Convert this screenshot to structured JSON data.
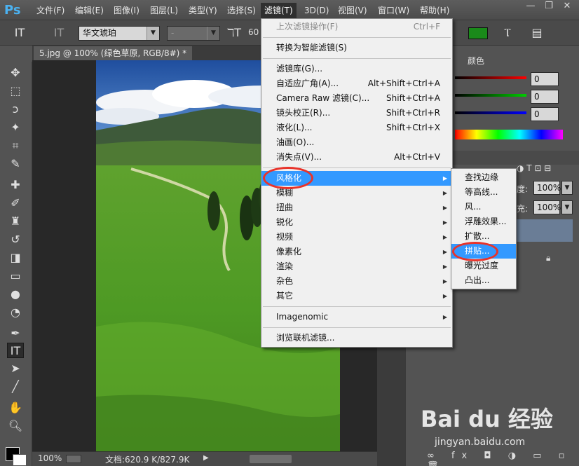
{
  "menubar": {
    "logo": "Ps",
    "items": [
      "文件(F)",
      "编辑(E)",
      "图像(I)",
      "图层(L)",
      "类型(Y)",
      "选择(S)",
      "滤镜(T)",
      "3D(D)",
      "视图(V)",
      "窗口(W)",
      "帮助(H)"
    ],
    "active_index": 6
  },
  "window_controls": {
    "minimize": "—",
    "restore": "❐",
    "close": "✕"
  },
  "options_bar": {
    "font_family": "华文琥珀",
    "font_style": "-",
    "font_size": "60"
  },
  "document": {
    "tab_title": "5.jpg @ 100% (绿色草原, RGB/8#) *",
    "zoom": "100%",
    "doc_info": "文档:620.9 K/827.9K"
  },
  "color_panel": {
    "tab": "颜色",
    "r": "0",
    "g": "0",
    "b": "0"
  },
  "layers_panel": {
    "opacity_label": "度:",
    "opacity_value": "100%",
    "fill_label": "充:",
    "fill_value": "100%"
  },
  "filter_menu": {
    "items": [
      {
        "label": "上次滤镜操作(F)",
        "shortcut": "Ctrl+F",
        "disabled": true
      },
      {
        "label": "转换为智能滤镜(S)",
        "shortcut": ""
      },
      {
        "label": "滤镜库(G)...",
        "shortcut": ""
      },
      {
        "label": "自适应广角(A)...",
        "shortcut": "Alt+Shift+Ctrl+A"
      },
      {
        "label": "Camera Raw 滤镜(C)...",
        "shortcut": "Shift+Ctrl+A"
      },
      {
        "label": "镜头校正(R)...",
        "shortcut": "Shift+Ctrl+R"
      },
      {
        "label": "液化(L)...",
        "shortcut": "Shift+Ctrl+X"
      },
      {
        "label": "油画(O)...",
        "shortcut": ""
      },
      {
        "label": "消失点(V)...",
        "shortcut": "Alt+Ctrl+V"
      },
      {
        "label": "风格化",
        "submenu": true,
        "highlight": true
      },
      {
        "label": "模糊",
        "submenu": true
      },
      {
        "label": "扭曲",
        "submenu": true
      },
      {
        "label": "锐化",
        "submenu": true
      },
      {
        "label": "视频",
        "submenu": true
      },
      {
        "label": "像素化",
        "submenu": true
      },
      {
        "label": "渲染",
        "submenu": true
      },
      {
        "label": "杂色",
        "submenu": true
      },
      {
        "label": "其它",
        "submenu": true
      },
      {
        "label": "Imagenomic",
        "submenu": true
      },
      {
        "label": "浏览联机滤镜...",
        "shortcut": ""
      }
    ]
  },
  "stylize_submenu": {
    "items": [
      "查找边缘",
      "等高线...",
      "风...",
      "浮雕效果...",
      "扩散...",
      "拼贴...",
      "曝光过度",
      "凸出..."
    ],
    "highlight_index": 5
  },
  "watermark": {
    "logo": "Bai du 经验",
    "url": "jingyan.baidu.com"
  },
  "colors": {
    "highlight": "#3399ff",
    "annotation": "#e8332a",
    "ps_blue": "#4bb2f1"
  }
}
